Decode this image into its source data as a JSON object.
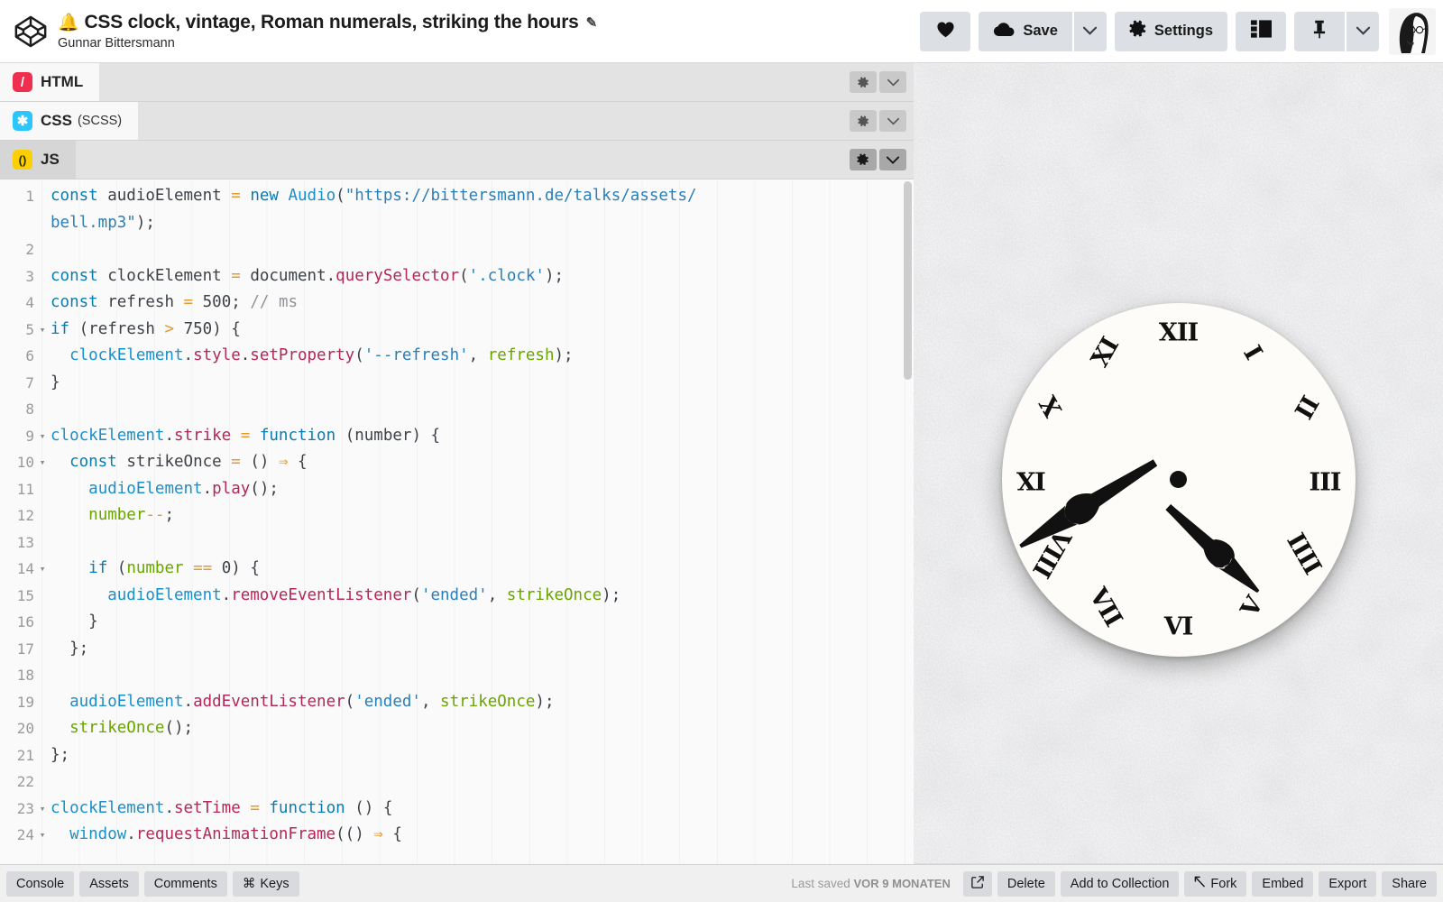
{
  "header": {
    "logo_icon": "codepen-logo-icon",
    "bell_emoji": "🔔",
    "pen_title": "CSS clock, vintage, Roman numerals, striking the hours",
    "edit_icon": "pencil-edit-icon",
    "author": "Gunnar Bittersmann",
    "buttons": {
      "love": {
        "icon": "heart-icon",
        "label": ""
      },
      "save": {
        "icon": "cloud-icon",
        "label": "Save",
        "caret": "chevron-down-icon"
      },
      "settings": {
        "icon": "gear-icon",
        "label": "Settings"
      },
      "layout": {
        "icon": "layout-panels-icon",
        "label": ""
      },
      "pin": {
        "icon": "pin-icon",
        "label": "",
        "caret": "chevron-down-icon"
      },
      "avatar": {
        "icon": "user-avatar",
        "label": ""
      }
    }
  },
  "editor_panels": [
    {
      "id": "html",
      "label": "HTML",
      "sub": "",
      "icon": "html-logo-icon",
      "icon_glyph": "/",
      "color": "#f02e4f",
      "active": false,
      "gear_icon": "gear-icon",
      "chevron_icon": "chevron-down-icon"
    },
    {
      "id": "css",
      "label": "CSS",
      "sub": "(SCSS)",
      "icon": "css-logo-icon",
      "icon_glyph": "✱",
      "color": "#2bc7fb",
      "active": false,
      "gear_icon": "gear-icon",
      "chevron_icon": "chevron-down-icon"
    },
    {
      "id": "js",
      "label": "JS",
      "sub": "",
      "icon": "js-logo-icon",
      "icon_glyph": "()",
      "color": "#fcd000",
      "active": true,
      "gear_icon": "gear-icon",
      "chevron_icon": "chevron-down-icon"
    }
  ],
  "code": {
    "language": "JS",
    "lines": [
      {
        "n": "1",
        "fold": "",
        "wrapped": true
      },
      {
        "n": "2",
        "fold": ""
      },
      {
        "n": "3",
        "fold": ""
      },
      {
        "n": "4",
        "fold": ""
      },
      {
        "n": "5",
        "fold": "▾"
      },
      {
        "n": "6",
        "fold": ""
      },
      {
        "n": "7",
        "fold": ""
      },
      {
        "n": "8",
        "fold": ""
      },
      {
        "n": "9",
        "fold": "▾"
      },
      {
        "n": "10",
        "fold": "▾"
      },
      {
        "n": "11",
        "fold": ""
      },
      {
        "n": "12",
        "fold": ""
      },
      {
        "n": "13",
        "fold": ""
      },
      {
        "n": "14",
        "fold": "▾"
      },
      {
        "n": "15",
        "fold": ""
      },
      {
        "n": "16",
        "fold": ""
      },
      {
        "n": "17",
        "fold": ""
      },
      {
        "n": "18",
        "fold": ""
      },
      {
        "n": "19",
        "fold": ""
      },
      {
        "n": "20",
        "fold": ""
      },
      {
        "n": "21",
        "fold": ""
      },
      {
        "n": "22",
        "fold": ""
      },
      {
        "n": "23",
        "fold": "▾"
      },
      {
        "n": "24",
        "fold": "▾"
      }
    ],
    "text": [
      "const audioElement = new Audio(\"https://bittersmann.de/talks/assets/bell.mp3\");",
      "",
      "const clockElement = document.querySelector('.clock');",
      "const refresh = 500; // ms",
      "if (refresh > 750) {",
      "  clockElement.style.setProperty('--refresh', refresh);",
      "}",
      "",
      "clockElement.strike = function (number) {",
      "  const strikeOnce = () => {",
      "    audioElement.play();",
      "    number--;",
      "",
      "    if (number == 0) {",
      "      audioElement.removeEventListener('ended', strikeOnce);",
      "    }",
      "  };",
      "",
      "  audioElement.addEventListener('ended', strikeOnce);",
      "  strikeOnce();",
      "};",
      "",
      "clockElement.setTime = function () {",
      "  window.requestAnimationFrame(() => {"
    ]
  },
  "preview": {
    "clock": {
      "numerals": [
        "XII",
        "I",
        "II",
        "III",
        "IIII",
        "V",
        "VI",
        "VII",
        "VIII",
        "IX",
        "X",
        "XI"
      ],
      "face_color": "#fdfcf8",
      "hand_color": "#111111",
      "hour_angle_deg": 133,
      "minute_angle_deg": 238,
      "displayed_time": "4:36"
    },
    "background": "light gray plaster wall texture"
  },
  "footer": {
    "left_buttons": [
      {
        "label": "Console",
        "icon": ""
      },
      {
        "label": "Assets",
        "icon": ""
      },
      {
        "label": "Comments",
        "icon": ""
      },
      {
        "label": "Keys",
        "icon": "⌘"
      }
    ],
    "saved_prefix": "Last saved",
    "saved_value": "VOR 9 MONATEN",
    "right_buttons": [
      {
        "label": "",
        "icon": "external-link-icon"
      },
      {
        "label": "Delete",
        "icon": ""
      },
      {
        "label": "Add to Collection",
        "icon": ""
      },
      {
        "label": "Fork",
        "icon": "fork-icon"
      },
      {
        "label": "Embed",
        "icon": ""
      },
      {
        "label": "Export",
        "icon": ""
      },
      {
        "label": "Share",
        "icon": ""
      }
    ]
  }
}
